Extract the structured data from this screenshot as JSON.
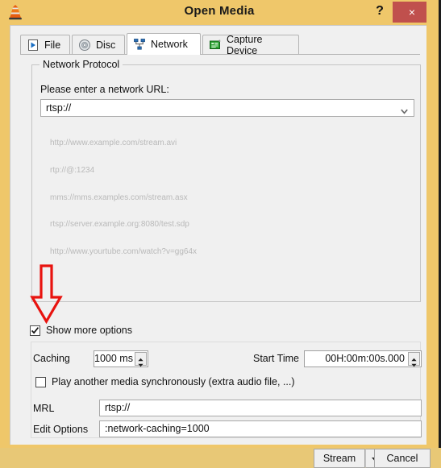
{
  "window": {
    "title": "Open Media",
    "app_icon": "vlc-cone-icon",
    "help_label": "?",
    "close_label": "×",
    "titlebar_color": "#efc76a",
    "close_button_color": "#c0504d"
  },
  "tabs": [
    {
      "id": "file",
      "label": "File",
      "icon": "file-play-icon",
      "active": false
    },
    {
      "id": "disc",
      "label": "Disc",
      "icon": "disc-icon",
      "active": false
    },
    {
      "id": "network",
      "label": "Network",
      "icon": "network-icon",
      "active": true
    },
    {
      "id": "capture",
      "label": "Capture Device",
      "icon": "capture-card-icon",
      "active": false
    }
  ],
  "network_protocol": {
    "group_title": "Network Protocol",
    "prompt": "Please enter a network URL:",
    "url_value": "rtsp://",
    "dropdown_icon": "chevron-down-icon",
    "examples": [
      "http://www.example.com/stream.avi",
      "rtp://@:1234",
      "mms://mms.examples.com/stream.asx",
      "rtsp://server.example.org:8080/test.sdp",
      "http://www.yourtube.com/watch?v=gg64x"
    ],
    "examples_color": "#b9b9b9"
  },
  "annotation": {
    "arrow_icon": "red-down-arrow-annotation",
    "color": "#e8130f",
    "points_to": "show-more-options-checkbox"
  },
  "show_more_options": {
    "label": "Show more options",
    "checked": true,
    "check_icon": "checkmark-icon"
  },
  "advanced": {
    "caching_label": "Caching",
    "caching_value": "1000 ms",
    "start_time_label": "Start Time",
    "start_time_value": "00H:00m:00s.000",
    "spinner_up_icon": "spinner-up-arrow-icon",
    "spinner_down_icon": "spinner-down-arrow-icon",
    "play_sync_label": "Play another media synchronously (extra audio file, ...)",
    "play_sync_checked": false,
    "mrl_label": "MRL",
    "mrl_value": "rtsp://",
    "edit_options_label": "Edit Options",
    "edit_options_value": ":network-caching=1000"
  },
  "buttons": {
    "stream_label": "Stream",
    "stream_menu_icon": "chevron-down-icon",
    "cancel_label": "Cancel"
  }
}
